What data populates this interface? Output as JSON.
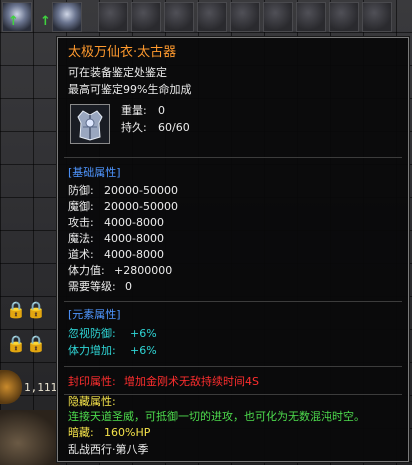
{
  "inventory": {
    "gold_amount": "1,111"
  },
  "tooltip": {
    "item_name": "太极万仙衣·太古器",
    "appraisal_line1": "可在装备鉴定处鉴定",
    "appraisal_line2": "最高可鉴定99%生命加成",
    "weight_label": "重量:",
    "weight_value": "0",
    "durability_label": "持久:",
    "durability_value": "60/60",
    "base_section_title": "[基础属性]",
    "base_stats": [
      {
        "label": "防御:",
        "value": "20000-50000"
      },
      {
        "label": "魔御:",
        "value": "20000-50000"
      },
      {
        "label": "攻击:",
        "value": "4000-8000"
      },
      {
        "label": "魔法:",
        "value": "4000-8000"
      },
      {
        "label": "道术:",
        "value": "4000-8000"
      },
      {
        "label": "体力值:",
        "value": "+2800000"
      },
      {
        "label": "需要等级:",
        "value": "0"
      }
    ],
    "element_section_title": "[元素属性]",
    "element_stats": [
      {
        "label": "忽视防御:",
        "value": "+6%"
      },
      {
        "label": "体力增加:",
        "value": "+6%"
      }
    ],
    "seal_label": "封印属性:",
    "seal_text": "增加金刚术无敌持续时间4S",
    "hidden_label": "隐藏属性:",
    "hidden_text": "连接天道圣威，可抵御一切的进攻，也可化为无数混沌时空。",
    "dark_label": "暗藏:",
    "dark_text": "160%HP",
    "season_text": "乱战西行·第八季"
  },
  "colors": {
    "name": "#ff9a2e",
    "section": "#4f96ff",
    "element": "#2fd6d6",
    "seal": "#ff2e2e",
    "hidden": "#4ddc4d",
    "dark": "#f5e34a"
  }
}
